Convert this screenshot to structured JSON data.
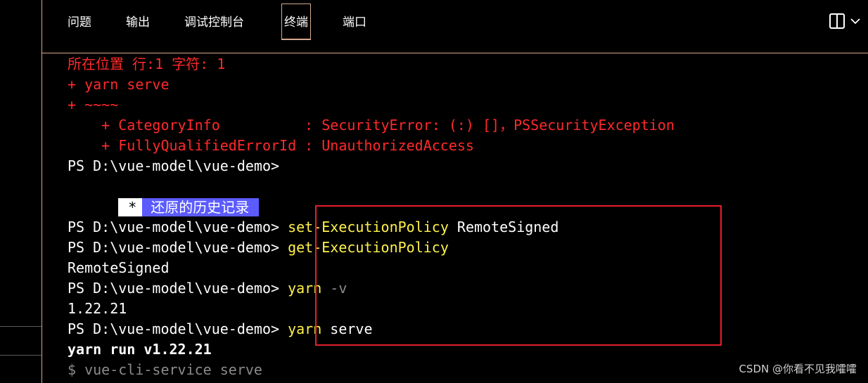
{
  "tabs": [
    {
      "label": "问题"
    },
    {
      "label": "输出"
    },
    {
      "label": "调试控制台"
    },
    {
      "label": "终端",
      "active": true
    },
    {
      "label": "端口"
    }
  ],
  "toolbar": {
    "layout_icon": "split-layout-icon",
    "chevron_icon": "chevron-down-icon"
  },
  "terminal": {
    "error_location": "所在位置 行:1 字符: 1",
    "error_cmd": "+ yarn serve",
    "error_tilde": "+ ~~~~",
    "category_info": "    + CategoryInfo          : SecurityError: (:) []，PSSecurityException",
    "fqeid": "    + FullyQualifiedErrorId : UnauthorizedAccess",
    "prompt_plain": "PS D:\\vue-model\\vue-demo>",
    "restore_star": "*",
    "restore_text": "还原的历史记录",
    "prompt": "PS D:\\vue-model\\vue-demo>",
    "cmd1_name": "set-ExecutionPolicy",
    "cmd1_arg": " RemoteSigned",
    "cmd2_name": "get-ExecutionPolicy",
    "out2": "RemoteSigned",
    "cmd3_name": "yarn",
    "cmd3_arg": " -v",
    "out3": "1.22.21",
    "cmd4_name": "yarn",
    "cmd4_arg": " serve",
    "yarn_run": "yarn run v1.22.21",
    "vue_cli": "$ vue-cli-service serve"
  },
  "colors": {
    "error": "#ff2a2a",
    "command": "#fff24a",
    "highlight_box": "#e3202a",
    "restore_bg": "#5b5bff"
  },
  "watermark": "CSDN @你看不见我嚯嚯"
}
